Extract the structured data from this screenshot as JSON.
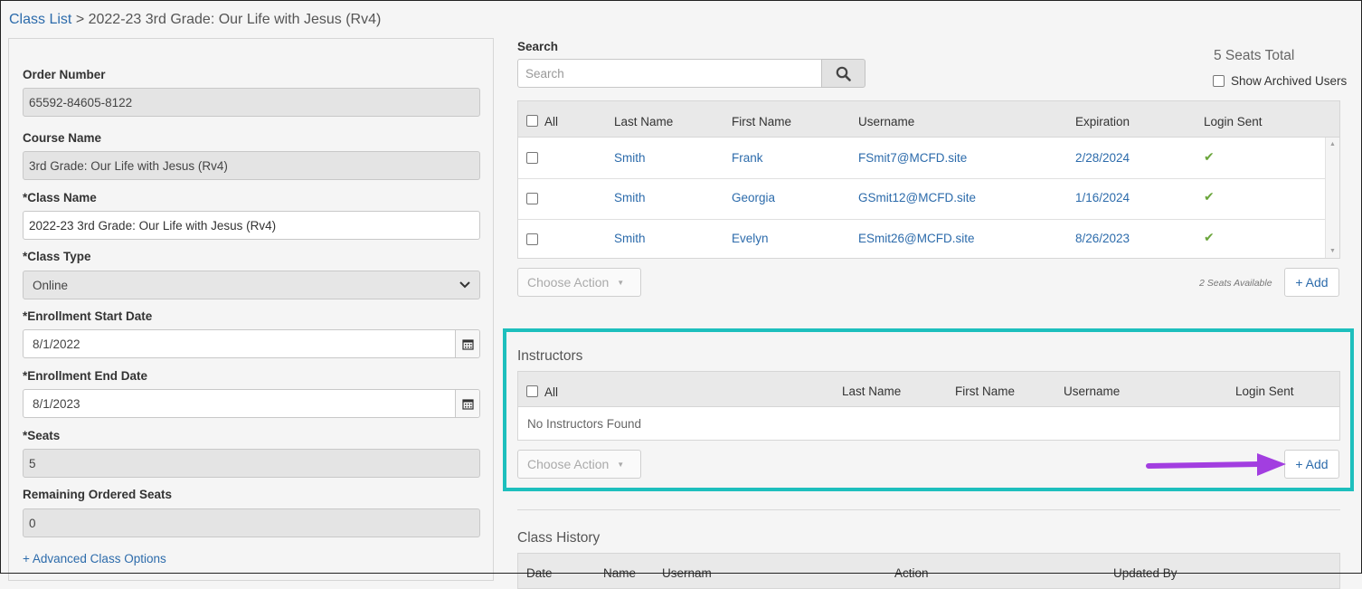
{
  "breadcrumb": {
    "root": "Class List",
    "separator": ">",
    "current": "2022-23 3rd Grade: Our Life with Jesus (Rv4)"
  },
  "form": {
    "order_number": {
      "label": "Order Number",
      "value": "65592-84605-8122"
    },
    "course_name": {
      "label": "Course Name",
      "value": "3rd Grade: Our Life with Jesus (Rv4)"
    },
    "class_name": {
      "label": "*Class Name",
      "value": "2022-23 3rd Grade: Our Life with Jesus (Rv4)"
    },
    "class_type": {
      "label": "*Class Type",
      "value": "Online"
    },
    "enroll_start": {
      "label": "*Enrollment Start Date",
      "value": "8/1/2022"
    },
    "enroll_end": {
      "label": "*Enrollment End Date",
      "value": "8/1/2023"
    },
    "seats": {
      "label": "*Seats",
      "value": "5"
    },
    "remaining": {
      "label": "Remaining Ordered Seats",
      "value": "0"
    },
    "advanced_link": "+ Advanced Class Options"
  },
  "search": {
    "label": "Search",
    "placeholder": "Search"
  },
  "seats_total": "5 Seats Total",
  "show_archived": "Show Archived Users",
  "students": {
    "headers": {
      "all": "All",
      "last": "Last Name",
      "first": "First Name",
      "username": "Username",
      "expiration": "Expiration",
      "login": "Login Sent"
    },
    "rows": [
      {
        "last": "Smith",
        "first": "Frank",
        "username": "FSmit7@MCFD.site",
        "expiration": "2/28/2024",
        "login": "✔"
      },
      {
        "last": "Smith",
        "first": "Georgia",
        "username": "GSmit12@MCFD.site",
        "expiration": "1/16/2024",
        "login": "✔"
      },
      {
        "last": "Smith",
        "first": "Evelyn",
        "username": "ESmit26@MCFD.site",
        "expiration": "8/26/2023",
        "login": "✔"
      }
    ],
    "choose_action": "Choose Action",
    "seats_available": "2 Seats Available",
    "add": "+ Add"
  },
  "instructors": {
    "title": "Instructors",
    "headers": {
      "all": "All",
      "last": "Last Name",
      "first": "First Name",
      "username": "Username",
      "login": "Login Sent"
    },
    "empty": "No Instructors Found",
    "choose_action": "Choose Action",
    "add": "+ Add"
  },
  "history": {
    "title": "Class History",
    "headers": {
      "date": "Date",
      "name": "Name",
      "username": "Usernam",
      "action": "Action",
      "updated_by": "Updated By"
    }
  },
  "colors": {
    "link": "#2c6bab",
    "highlight": "#1dbfbd",
    "arrow": "#a23ee0",
    "check": "#6aa53b"
  }
}
